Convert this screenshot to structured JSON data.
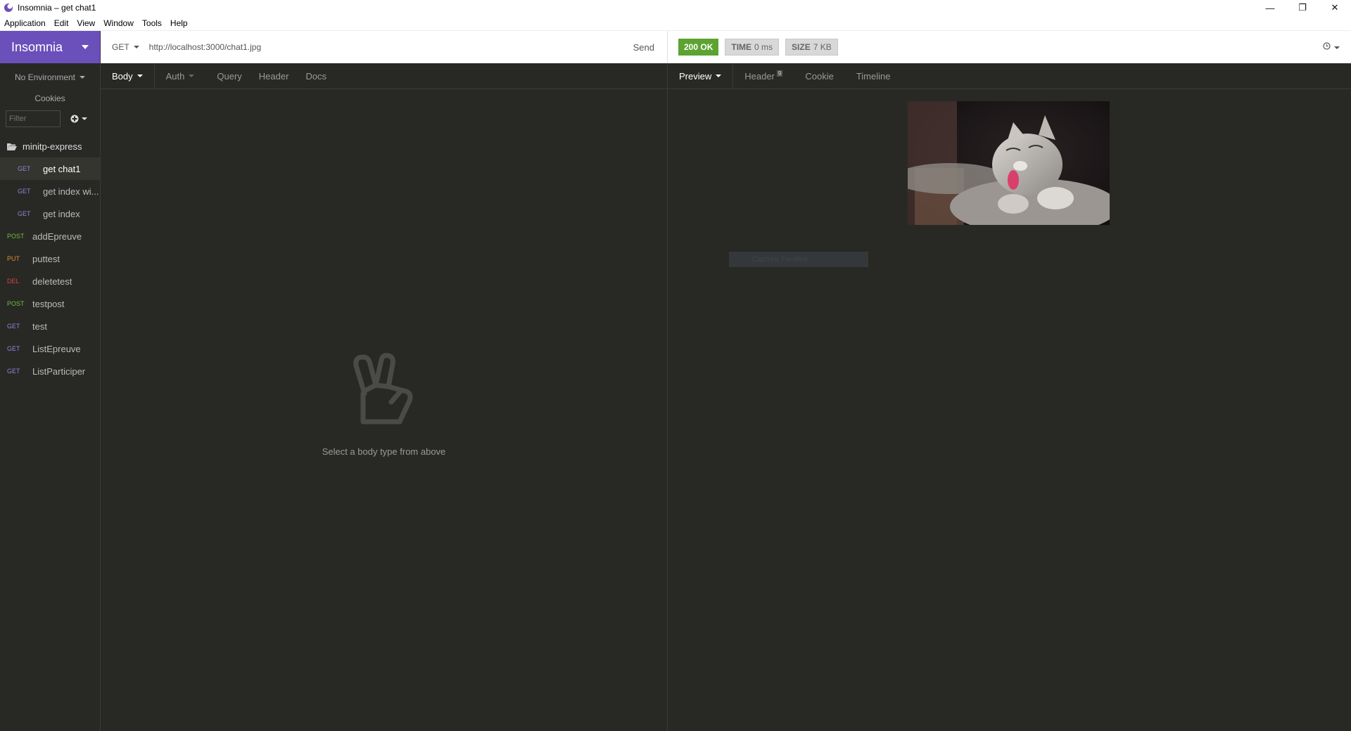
{
  "window": {
    "title": "Insomnia – get chat1"
  },
  "menu": [
    "Application",
    "Edit",
    "View",
    "Window",
    "Tools",
    "Help"
  ],
  "sidebar": {
    "brand": "Insomnia",
    "environment": "No Environment",
    "cookies": "Cookies",
    "filter_placeholder": "Filter",
    "folder": "minitp-express",
    "items": [
      {
        "method": "GET",
        "name": "get chat1"
      },
      {
        "method": "GET",
        "name": "get index wi..."
      },
      {
        "method": "GET",
        "name": "get index"
      },
      {
        "method": "POST",
        "name": "addEpreuve"
      },
      {
        "method": "PUT",
        "name": "puttest"
      },
      {
        "method": "DEL",
        "name": "deletetest"
      },
      {
        "method": "POST",
        "name": "testpost"
      },
      {
        "method": "GET",
        "name": "test"
      },
      {
        "method": "GET",
        "name": "ListEpreuve"
      },
      {
        "method": "GET",
        "name": "ListParticiper"
      }
    ]
  },
  "request": {
    "method": "GET",
    "url": "http://localhost:3000/chat1.jpg",
    "send": "Send",
    "tabs": {
      "body": "Body",
      "auth": "Auth",
      "query": "Query",
      "header": "Header",
      "docs": "Docs"
    },
    "empty_message": "Select a body type from above"
  },
  "response": {
    "status": "200 OK",
    "time_label": "TIME",
    "time_value": "0 ms",
    "size_label": "SIZE",
    "size_value": "7 KB",
    "tabs": {
      "preview": "Preview",
      "header": "Header",
      "header_count": "9",
      "cookie": "Cookie",
      "timeline": "Timeline"
    },
    "ghost_text": "Capture Fenêtre"
  },
  "colors": {
    "brand": "#6b4fbb",
    "ok": "#5da331",
    "bg": "#282925"
  }
}
